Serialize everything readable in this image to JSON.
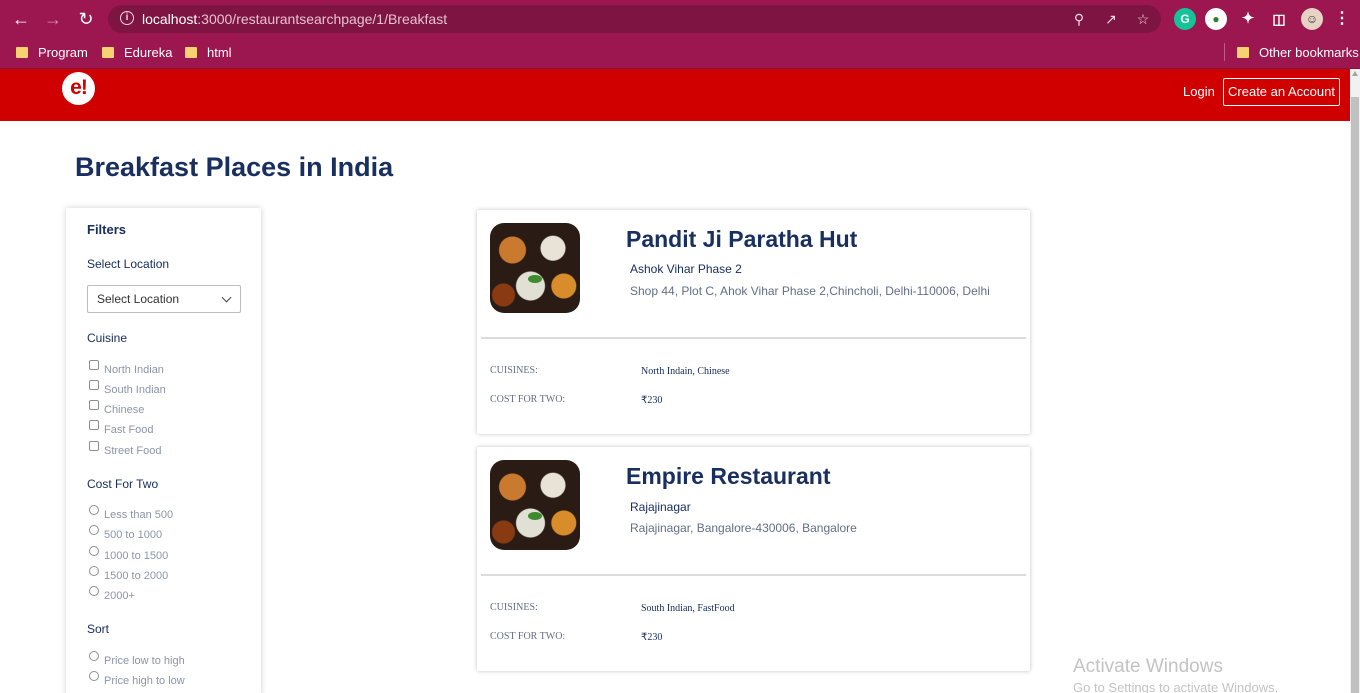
{
  "browser": {
    "url_host": "localhost",
    "url_path": ":3000/restaurantsearchpage/1/Breakfast",
    "bookmarks": [
      "Program",
      "Edureka",
      "html"
    ],
    "other_bookmarks": "Other bookmarks"
  },
  "header": {
    "logo": "e!",
    "login": "Login",
    "create_account": "Create an Account"
  },
  "page_title": "Breakfast Places in India",
  "filters": {
    "title": "Filters",
    "location_label": "Select Location",
    "location_select": "Select Location",
    "cuisine_label": "Cuisine",
    "cuisines": [
      "North Indian",
      "South Indian",
      "Chinese",
      "Fast Food",
      "Street Food"
    ],
    "cost_label": "Cost For Two",
    "costs": [
      "Less than 500",
      "500 to 1000",
      "1000 to 1500",
      "1500 to 2000",
      "2000+"
    ],
    "sort_label": "Sort",
    "sorts": [
      "Price low to high",
      "Price high to low"
    ]
  },
  "results": [
    {
      "name": "Pandit Ji Paratha Hut",
      "locality": "Ashok Vihar Phase 2",
      "address": "Shop 44, Plot C, Ahok Vihar Phase 2,Chincholi, Delhi-110006, Delhi",
      "cuisines_label": "CUISINES:",
      "cuisines": "North Indain, Chinese",
      "cost_label": "COST FOR TWO:",
      "cost": "₹230"
    },
    {
      "name": "Empire Restaurant",
      "locality": "Rajajinagar",
      "address": "Rajajinagar, Bangalore-430006, Bangalore",
      "cuisines_label": "CUISINES:",
      "cuisines": "South Indian, FastFood",
      "cost_label": "COST FOR TWO:",
      "cost": "₹230"
    }
  ],
  "watermark": {
    "line1": "Activate Windows",
    "line2": "Go to Settings to activate Windows."
  }
}
